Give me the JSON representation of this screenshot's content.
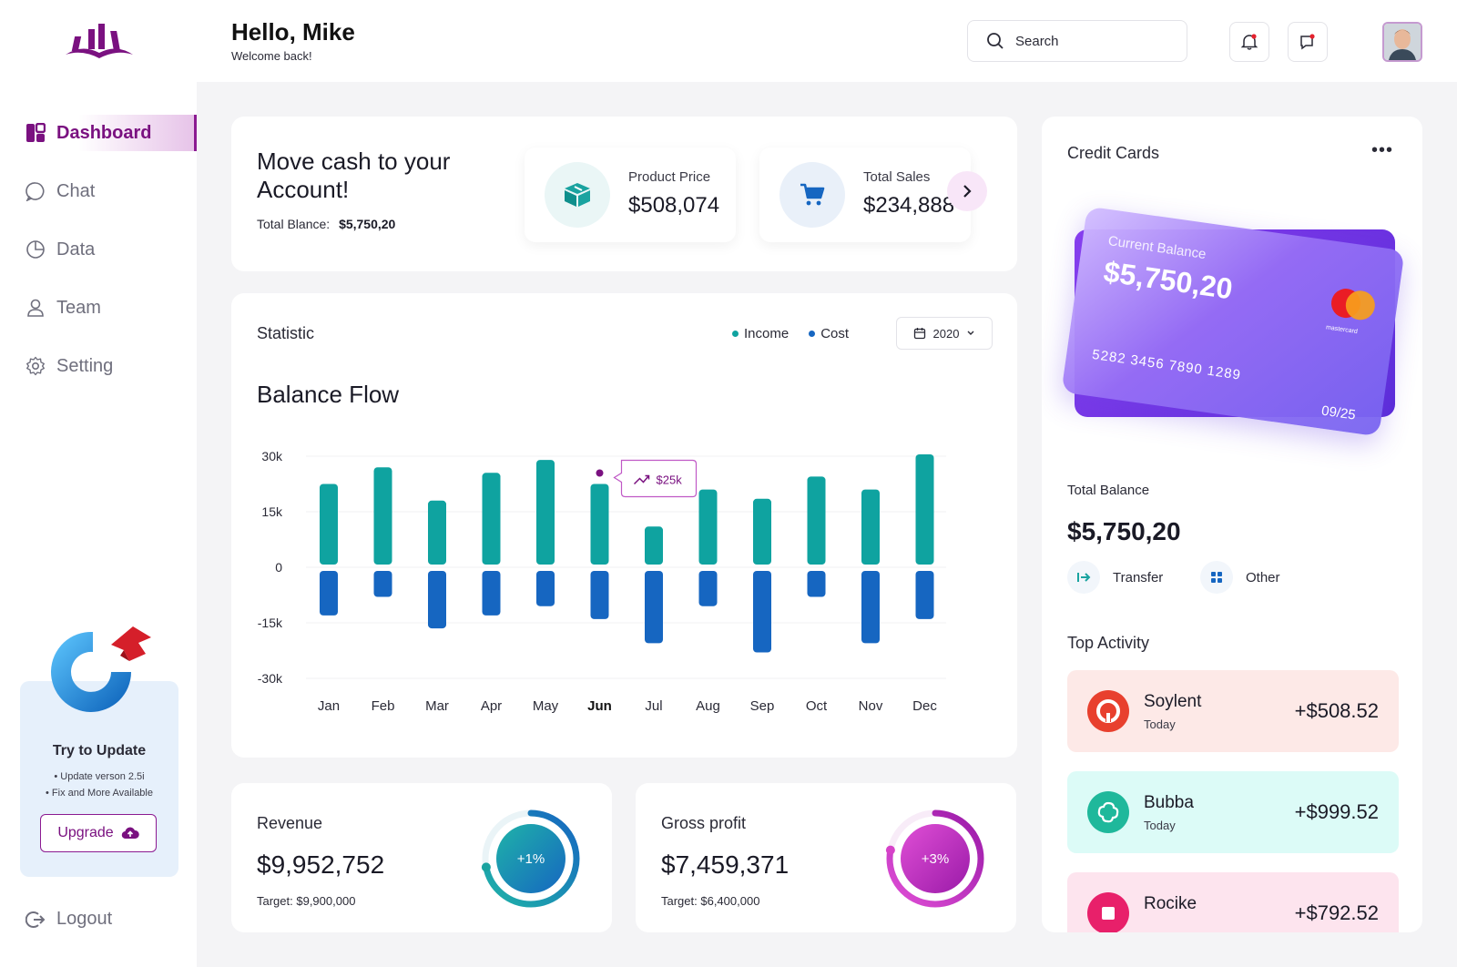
{
  "header": {
    "greeting": "Hello, Mike",
    "welcome": "Welcome back!",
    "search_placeholder": "Search"
  },
  "sidebar": {
    "items": [
      {
        "label": "Dashboard",
        "icon": "dashboard-icon",
        "active": true
      },
      {
        "label": "Chat",
        "icon": "chat-icon"
      },
      {
        "label": "Data",
        "icon": "pie-chart-icon"
      },
      {
        "label": "Team",
        "icon": "user-icon"
      },
      {
        "label": "Setting",
        "icon": "gear-icon"
      }
    ],
    "update": {
      "title": "Try to Update",
      "line1": "• Update verson 2.5i",
      "line2": "• Fix and More Available",
      "button": "Upgrade"
    },
    "logout": "Logout"
  },
  "top": {
    "title": "Move cash to your Account!",
    "total_label": "Total Blance:",
    "total_value": "$5,750,20",
    "product_label": "Product Price",
    "product_value": "$508,074",
    "sales_label": "Total Sales",
    "sales_value": "$234,888"
  },
  "statistic": {
    "title": "Statistic",
    "legend_income": "Income",
    "legend_cost": "Cost",
    "year": "2020",
    "chart_title": "Balance Flow",
    "tooltip": "$25k"
  },
  "chart_data": {
    "type": "bar",
    "title": "Balance Flow",
    "categories": [
      "Jan",
      "Feb",
      "Mar",
      "Apr",
      "May",
      "Jun",
      "Jul",
      "Aug",
      "Sep",
      "Oct",
      "Nov",
      "Dec"
    ],
    "series": [
      {
        "name": "Income",
        "values": [
          22.5,
          27,
          18,
          25.5,
          29,
          22.5,
          11,
          21,
          18.5,
          24.5,
          21,
          30.5
        ]
      },
      {
        "name": "Cost",
        "values": [
          -13,
          -8,
          -16.5,
          -13,
          -10.5,
          -14,
          -20.5,
          -10.5,
          -23,
          -8,
          -20.5,
          -14
        ]
      }
    ],
    "y_ticks": [
      "30k",
      "15k",
      "0",
      "-15k",
      "-30k"
    ],
    "ylim": [
      -30,
      30
    ],
    "highlight": "Jun",
    "colors": {
      "income": "#0fa3a0",
      "cost": "#1666c1"
    }
  },
  "revenue": {
    "title": "Revenue",
    "value": "$9,952,752",
    "target": "Target: $9,900,000",
    "change": "+1%",
    "progress": 0.72
  },
  "gross": {
    "title": "Gross profit",
    "value": "$7,459,371",
    "target": "Target: $6,400,000",
    "change": "+3%",
    "progress": 0.78
  },
  "credit": {
    "title": "Credit Cards",
    "card_label": "Current Balance",
    "card_balance": "$5,750,20",
    "card_number": "5282 3456 7890 1289",
    "card_expiry": "09/25",
    "card_brand": "mastercard",
    "total_label": "Total Balance",
    "total_value": "$5,750,20",
    "transfer": "Transfer",
    "other": "Other",
    "activity_title": "Top Activity",
    "activities": [
      {
        "name": "Soylent",
        "sub": "Today",
        "amount": "+$508.52"
      },
      {
        "name": "Bubba",
        "sub": "Today",
        "amount": "+$999.52"
      },
      {
        "name": "Rocike",
        "sub": "",
        "amount": "+$792.52"
      }
    ]
  }
}
